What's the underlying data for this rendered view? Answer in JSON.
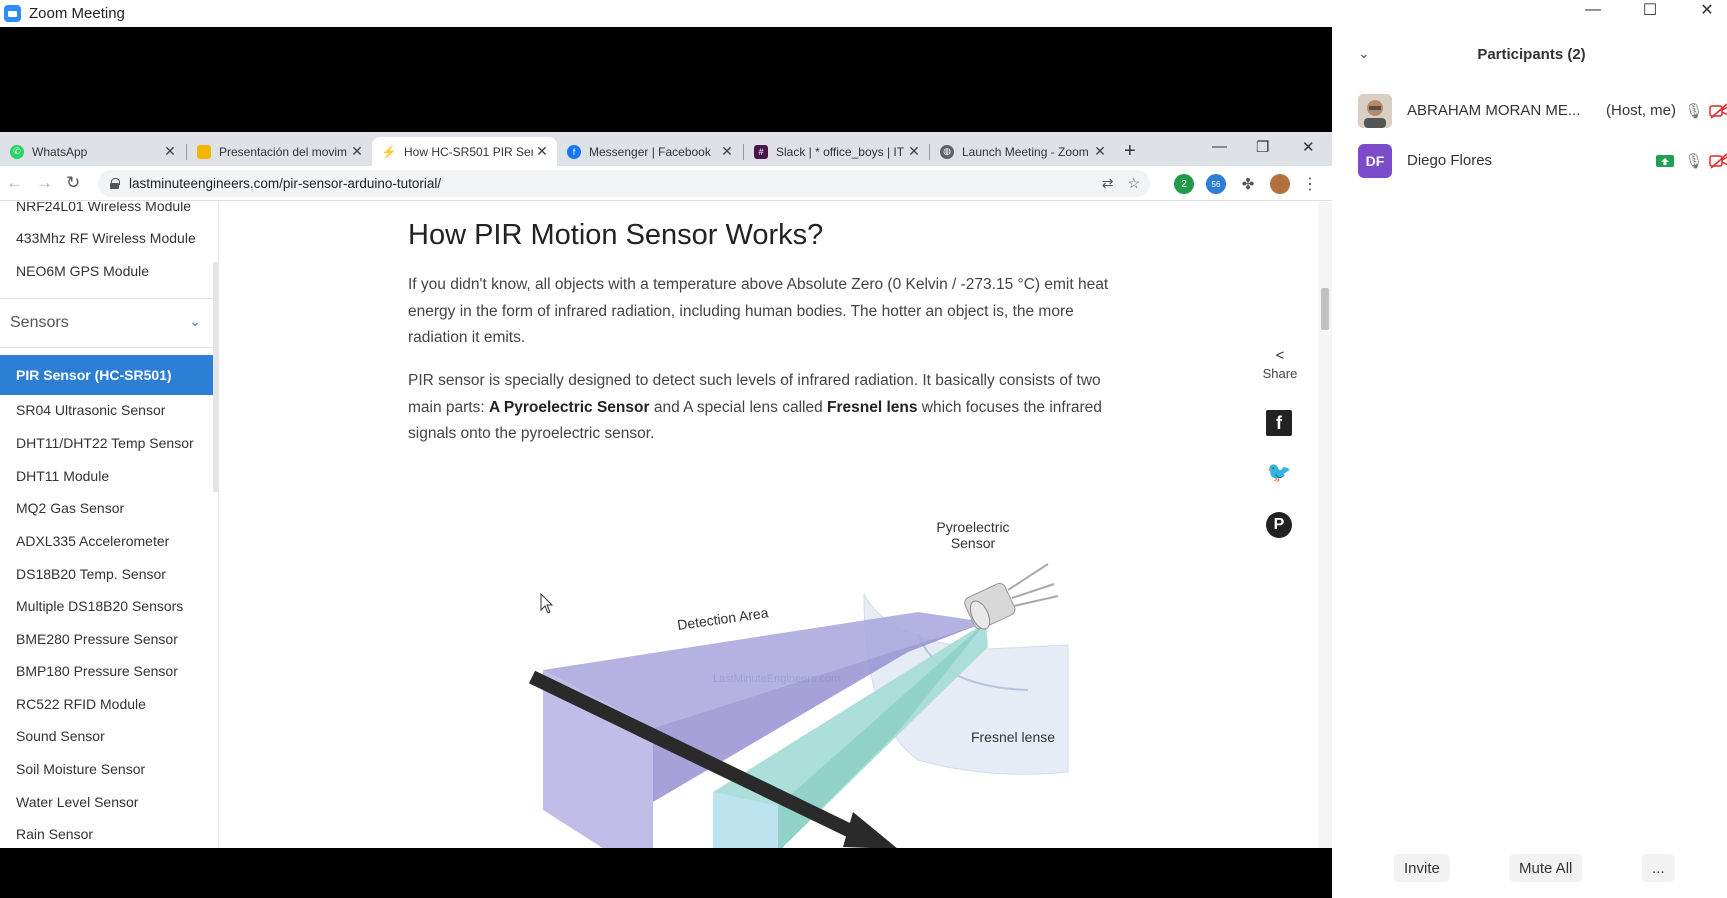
{
  "window": {
    "title": "Zoom Meeting",
    "controls": [
      "—",
      "☐",
      "✕"
    ]
  },
  "browser": {
    "tabs": [
      {
        "label": "WhatsApp",
        "icon": "whatsapp-icon",
        "color": "#25d366"
      },
      {
        "label": "Presentación del movim",
        "icon": "slides-icon",
        "color": "#f4b400"
      },
      {
        "label": "How HC-SR501 PIR Sen",
        "icon": "lme-icon",
        "color": "#f0a030"
      },
      {
        "label": "Messenger | Facebook",
        "icon": "facebook-icon",
        "color": "#1877f2"
      },
      {
        "label": "Slack | * office_boys | IT",
        "icon": "slack-icon",
        "color": "#4a154b"
      },
      {
        "label": "Launch Meeting - Zoom",
        "icon": "globe-icon",
        "color": "#5f6368"
      }
    ],
    "new_tab": "+",
    "url": "lastminuteengineers.com/pir-sensor-arduino-tutorial/",
    "ext_badges": [
      "2",
      "56"
    ]
  },
  "sidebar": {
    "top_items": [
      "NRF24L01 Wireless Module",
      "433Mhz RF Wireless Module",
      "NEO6M GPS Module"
    ],
    "section": "Sensors",
    "active": "PIR Sensor (HC-SR501)",
    "items": [
      "SR04 Ultrasonic Sensor",
      "DHT11/DHT22 Temp Sensor",
      "DHT11 Module",
      "MQ2 Gas Sensor",
      "ADXL335 Accelerometer",
      "DS18B20 Temp. Sensor",
      "Multiple DS18B20 Sensors",
      "BME280 Pressure Sensor",
      "BMP180 Pressure Sensor",
      "RC522 RFID Module",
      "Sound Sensor",
      "Soil Moisture Sensor",
      "Water Level Sensor",
      "Rain Sensor"
    ]
  },
  "article": {
    "heading": "How PIR Motion Sensor Works?",
    "p1": "If you didn't know, all objects with a temperature above Absolute Zero (0 Kelvin / -273.15 °C) emit heat energy in the form of infrared radiation, including human bodies. The hotter an object is, the more radiation it emits.",
    "p2_a": "PIR sensor is specially designed to detect such levels of infrared radiation. It basically consists of two main parts: ",
    "p2_b": "A Pyroelectric Sensor",
    "p2_c": " and A special lens called ",
    "p2_d": "Fresnel lens",
    "p2_e": " which focuses the infrared signals onto the pyroelectric sensor.",
    "figure": {
      "label_sensor_1": "Pyroelectric",
      "label_sensor_2": "Sensor",
      "label_detection": "Detection Area",
      "label_lens": "Fresnel lense",
      "watermark": "LastMinuteEngineers.com"
    }
  },
  "share": {
    "label": "Share"
  },
  "participants": {
    "title": "Participants (2)",
    "list": [
      {
        "name": "ABRAHAM MORAN ME...",
        "role": "(Host, me)",
        "initials": ""
      },
      {
        "name": "Diego Flores",
        "role": "",
        "initials": "DF"
      }
    ],
    "buttons": {
      "invite": "Invite",
      "mute_all": "Mute All",
      "more": "..."
    }
  }
}
